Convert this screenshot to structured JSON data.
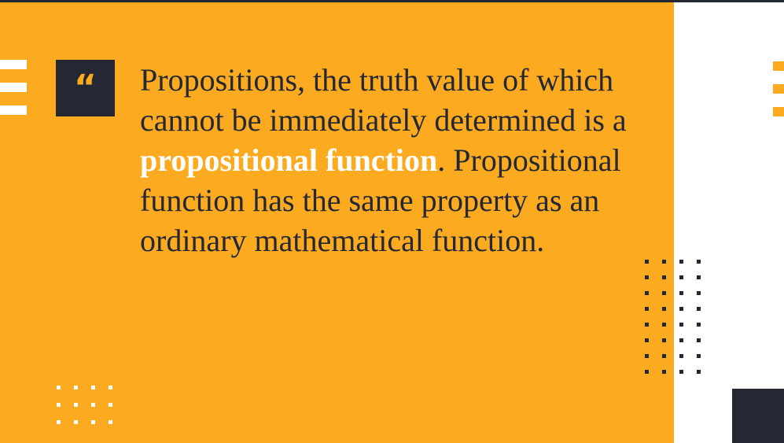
{
  "slide": {
    "quote_mark": "“",
    "quote": {
      "part1": "Propositions,  the truth value of which cannot be immediately determined is a ",
      "highlight": "propositional function",
      "part2": ". Propositional function has the same property as an ordinary mathematical function."
    }
  },
  "colors": {
    "accent": "#fcaa20",
    "dark": "#242833",
    "light": "#ffffff"
  },
  "decor": {
    "dark_dot_grid": {
      "rows": 8,
      "cols": 4
    },
    "white_dot_grid": {
      "rows": 3,
      "cols": 4
    }
  }
}
